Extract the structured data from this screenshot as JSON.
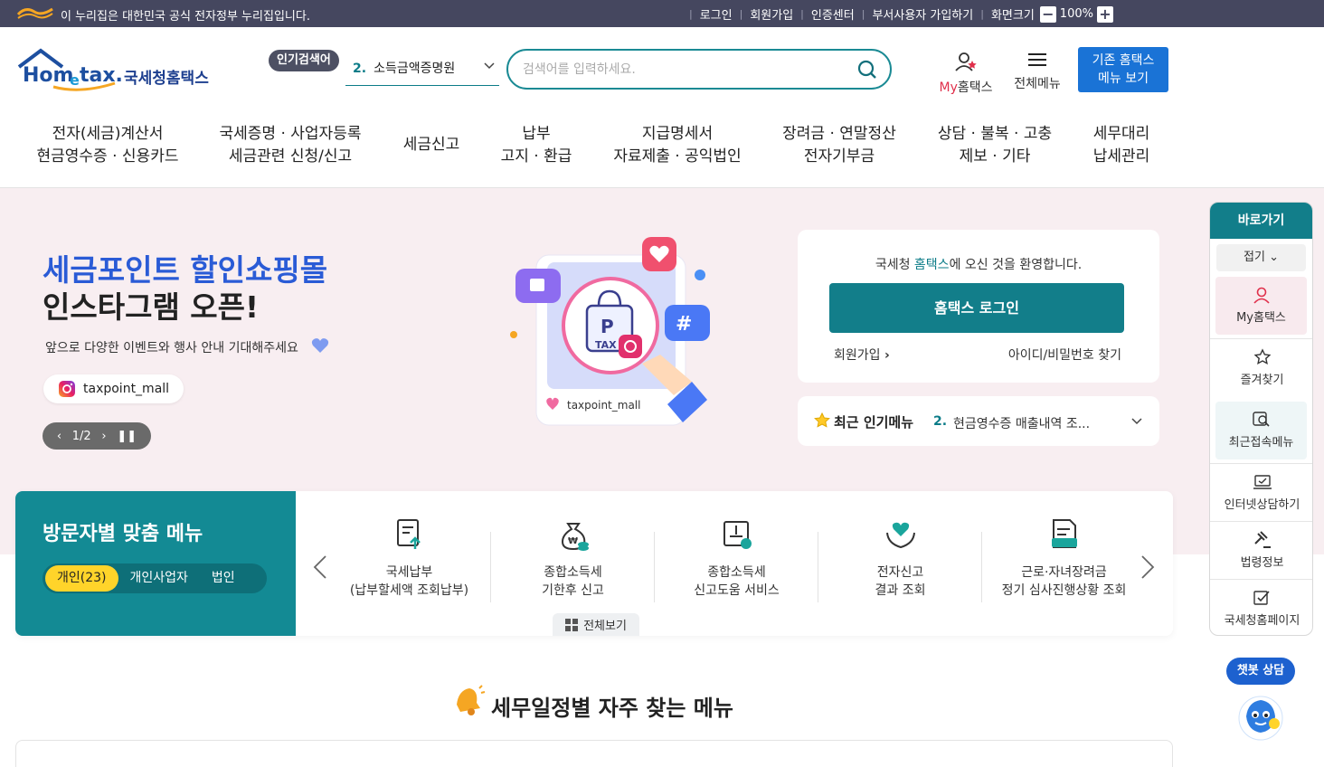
{
  "topbar": {
    "gov_notice": "이 누리집은 대한민국 공식 전자정부 누리집입니다.",
    "links": [
      "로그인",
      "회원가입",
      "인증센터",
      "부서사용자 가입하기",
      "화면크기"
    ],
    "zoom_minus": "−",
    "zoom_value": "100%",
    "zoom_plus": "+"
  },
  "header": {
    "logo_name": "국세청홈택스",
    "popular_badge": "인기검색어",
    "popular_rank": "2.",
    "popular_term": "소득금액증명원",
    "search_placeholder": "검색어를 입력하세요.",
    "my_prefix": "My",
    "my_suffix": "홈택스",
    "all_menu": "전체메뉴",
    "old_menu_line1": "기존 홈택스",
    "old_menu_line2": "메뉴 보기"
  },
  "gnb": [
    {
      "line1": "전자(세금)계산서",
      "line2": "현금영수증 · 신용카드"
    },
    {
      "line1": "국세증명 · 사업자등록",
      "line2": "세금관련 신청/신고"
    },
    {
      "line1": "세금신고",
      "line2": ""
    },
    {
      "line1": "납부",
      "line2": "고지 · 환급"
    },
    {
      "line1": "지급명세서",
      "line2": "자료제출 · 공익법인"
    },
    {
      "line1": "장려금 · 연말정산",
      "line2": "전자기부금"
    },
    {
      "line1": "상담 · 불복 · 고충",
      "line2": "제보 · 기타"
    },
    {
      "line1": "세무대리",
      "line2": "납세관리"
    }
  ],
  "hero": {
    "title1": "세금포인트 할인쇼핑몰",
    "title2": "인스타그램 오픈!",
    "subtitle": "앞으로 다양한 이벤트와 행사 안내 기대해주세요",
    "insta_handle": "taxpoint_mall",
    "pager": "1/2",
    "illust_tax_text": "TAX",
    "illust_p": "P",
    "illust_handle": "taxpoint_mall"
  },
  "welcome": {
    "text_pre": "국세청 ",
    "text_hl": "홈택스",
    "text_post": "에 오신 것을 환영합니다.",
    "login_button": "홈택스 로그인",
    "join": "회원가입",
    "find": "아이디/비밀번호 찾기"
  },
  "recent": {
    "label": "최근 인기메뉴",
    "rank": "2.",
    "value": "현금영수증 매출내역 조..."
  },
  "visitor": {
    "title": "방문자별 맞춤 메뉴",
    "tabs": [
      "개인(23)",
      "개인사업자",
      "법인"
    ],
    "items": [
      {
        "line1": "국세납부",
        "line2": "(납부할세액 조회납부)"
      },
      {
        "line1": "종합소득세",
        "line2": "기한후 신고"
      },
      {
        "line1": "종합소득세",
        "line2": "신고도움 서비스"
      },
      {
        "line1": "전자신고",
        "line2": "결과 조회"
      },
      {
        "line1": "근로·자녀장려금",
        "line2": "정기 심사진행상황 조회"
      }
    ],
    "view_all": "전체보기"
  },
  "schedule": {
    "title": "세무일정별 자주 찾는 메뉴"
  },
  "quick": {
    "title": "바로가기",
    "fold": "접기",
    "items": [
      "My홈택스",
      "즐겨찾기",
      "최근접속메뉴",
      "인터넷상담하기",
      "법령정보",
      "국세청홈페이지"
    ]
  },
  "chatbot": {
    "label": "챗봇 상담"
  },
  "colors": {
    "teal": "#127e8a",
    "navy": "#45475f",
    "blue": "#1a73d6",
    "hero_bg": "#f8eef1",
    "yellow": "#ffd42a"
  }
}
